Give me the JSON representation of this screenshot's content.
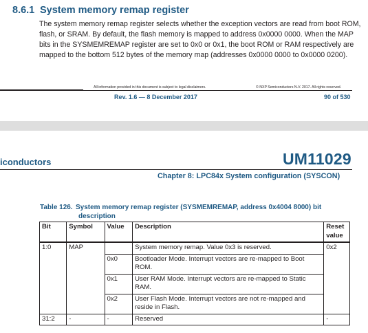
{
  "section": {
    "number": "8.6.1",
    "title": "System memory remap register",
    "paragraph": "The system memory remap register selects whether the exception vectors are read from boot ROM, flash, or SRAM. By default, the flash memory is mapped to address 0x0000 0000. When the MAP bits in the SYSMEMREMAP register are set to 0x0 or 0x1, the boot ROM or RAM respectively are mapped to the bottom 512 bytes of the memory map (addresses 0x0000 0000 to 0x0000 0200)."
  },
  "footer": {
    "disclaimer": "All information provided in this document is subject to legal disclaimers.",
    "copyright": "© NXP Semiconductors N.V. 2017. All rights reserved.",
    "revision": "Rev. 1.6 — 8 December 2017",
    "page": "90 of 530"
  },
  "header": {
    "company": "iconductors",
    "doc_id": "UM11029",
    "chapter": "Chapter 8: LPC84x System configuration (SYSCON)"
  },
  "table": {
    "caption_number": "Table 126.",
    "caption_text": "System memory remap register (SYSMEMREMAP, address 0x4004 8000) bit",
    "caption_text_2": "description",
    "columns": [
      "Bit",
      "Symbol",
      "Value",
      "Description",
      "Reset value"
    ],
    "rows": [
      {
        "bit": "1:0",
        "symbol": "MAP",
        "value": "",
        "description": "System memory remap. Value 0x3 is reserved.",
        "reset": "0x2"
      },
      {
        "bit": "",
        "symbol": "",
        "value": "0x0",
        "description": "Bootloader Mode. Interrupt vectors are re-mapped to Boot ROM.",
        "reset": ""
      },
      {
        "bit": "",
        "symbol": "",
        "value": "0x1",
        "description": "User RAM Mode. Interrupt vectors are re-mapped to Static RAM.",
        "reset": ""
      },
      {
        "bit": "",
        "symbol": "",
        "value": "0x2",
        "description": "User Flash Mode. Interrupt vectors are not re-mapped and reside in Flash.",
        "reset": ""
      },
      {
        "bit": "31:2",
        "symbol": "-",
        "value": "-",
        "description": "Reserved",
        "reset": "-"
      }
    ]
  }
}
